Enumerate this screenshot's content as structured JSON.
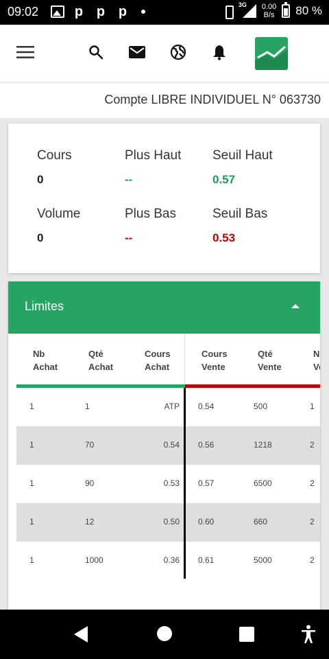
{
  "status_bar": {
    "time": "09:02",
    "network": "3G",
    "speed_value": "0.00",
    "speed_unit": "B/s",
    "battery": "80 %",
    "notification_letter": "p"
  },
  "app_bar": {
    "icons": [
      "menu-icon",
      "search-icon",
      "mail-icon",
      "globe-icon",
      "bell-icon",
      "app-logo"
    ]
  },
  "account": {
    "label": "Compte LIBRE INDIVIDUEL N° 063730"
  },
  "quote": {
    "cours_label": "Cours",
    "cours_value": "0",
    "plus_haut_label": "Plus Haut",
    "plus_haut_value": "--",
    "seuil_haut_label": "Seuil Haut",
    "seuil_haut_value": "0.57",
    "volume_label": "Volume",
    "volume_value": "0",
    "plus_bas_label": "Plus Bas",
    "plus_bas_value": "--",
    "seuil_bas_label": "Seuil Bas",
    "seuil_bas_value": "0.53"
  },
  "limits": {
    "title": "Limites",
    "headers": {
      "nb_achat": "Nb\nAchat",
      "qte_achat": "Qté\nAchat",
      "cours_achat": "Cours\nAchat",
      "cours_vente": "Cours\nVente",
      "qte_vente": "Qté\nVente",
      "nb_vente": "Nb\nVente"
    },
    "rows": [
      {
        "nb_achat": "1",
        "qte_achat": "1",
        "cours_achat": "ATP",
        "cours_vente": "0.54",
        "qte_vente": "500",
        "nb_vente": "1"
      },
      {
        "nb_achat": "1",
        "qte_achat": "70",
        "cours_achat": "0.54",
        "cours_vente": "0.56",
        "qte_vente": "1218",
        "nb_vente": "2"
      },
      {
        "nb_achat": "1",
        "qte_achat": "90",
        "cours_achat": "0.53",
        "cours_vente": "0.57",
        "qte_vente": "6500",
        "nb_vente": "2"
      },
      {
        "nb_achat": "1",
        "qte_achat": "12",
        "cours_achat": "0.50",
        "cours_vente": "0.60",
        "qte_vente": "660",
        "nb_vente": "2"
      },
      {
        "nb_achat": "1",
        "qte_achat": "1000",
        "cours_achat": "0.36",
        "cours_vente": "0.61",
        "qte_vente": "5000",
        "nb_vente": "2"
      }
    ]
  },
  "colors": {
    "brand_green": "#27a463",
    "sell_red": "#c00000"
  },
  "nav_bar": {
    "icons": [
      "back-icon",
      "home-icon",
      "recent-apps-icon",
      "accessibility-icon"
    ]
  }
}
